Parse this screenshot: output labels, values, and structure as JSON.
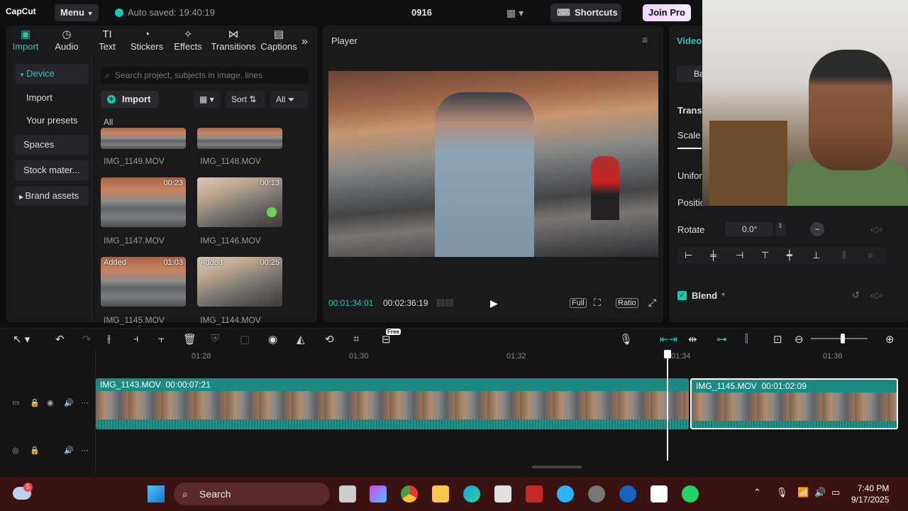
{
  "titlebar": {
    "logo": "CapCut",
    "menu_label": "Menu",
    "autosave": "Auto saved: 19:40:19",
    "project_title": "0916",
    "shortcuts_label": "Shortcuts",
    "join_pro_label": "Join Pro"
  },
  "left_tabs": [
    {
      "label": "Import",
      "icon": "import-icon"
    },
    {
      "label": "Audio",
      "icon": "audio-icon"
    },
    {
      "label": "Text",
      "icon": "text-icon"
    },
    {
      "label": "Stickers",
      "icon": "stickers-icon"
    },
    {
      "label": "Effects",
      "icon": "effects-icon"
    },
    {
      "label": "Transitions",
      "icon": "transitions-icon"
    },
    {
      "label": "Captions",
      "icon": "captions-icon"
    }
  ],
  "sidenav": {
    "device": "Device",
    "import": "Import",
    "presets": "Your presets",
    "spaces": "Spaces",
    "stock": "Stock mater...",
    "brand": "Brand assets"
  },
  "media": {
    "search_placeholder": "Search project, subjects in image, lines",
    "import_label": "Import",
    "sort_label": "Sort",
    "all_filter": "All",
    "section_all": "All",
    "items": [
      {
        "name": "IMG_1149.MOV",
        "duration": "",
        "added": ""
      },
      {
        "name": "IMG_1148.MOV",
        "duration": "",
        "added": ""
      },
      {
        "name": "IMG_1147.MOV",
        "duration": "00:23",
        "added": ""
      },
      {
        "name": "IMG_1146.MOV",
        "duration": "00:13",
        "added": ""
      },
      {
        "name": "IMG_1145.MOV",
        "duration": "01:03",
        "added": "Added"
      },
      {
        "name": "IMG_1144.MOV",
        "duration": "00:25",
        "added": "Added"
      }
    ]
  },
  "player": {
    "title": "Player",
    "current_time": "00:01:34:01",
    "total_time": "00:02:36:19",
    "full_label": "Full",
    "ratio_label": "Ratio"
  },
  "properties": {
    "tab_video": "Video",
    "basic": "Ba",
    "transform": "Transf",
    "scale": "Scale",
    "uniform": "Unifor",
    "position": "Positio",
    "rotate": "Rotate",
    "rotate_value": "0.0°",
    "blend": "Blend"
  },
  "timeline": {
    "ruler": [
      "01:28",
      "01:30",
      "01:32",
      "01:34",
      "01:36"
    ],
    "free_badge": "Free",
    "clips": [
      {
        "name": "IMG_1143.MOV",
        "duration": "00:00:07:21"
      },
      {
        "name": "IMG_1145.MOV",
        "duration": "00:01:02:09"
      }
    ]
  },
  "taskbar": {
    "search_label": "Search",
    "notif_count": "5",
    "time": "7:40 PM",
    "date": "9/17/2025"
  }
}
